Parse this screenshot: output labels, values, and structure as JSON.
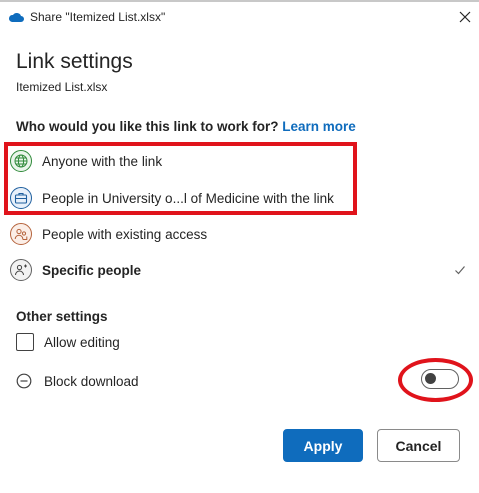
{
  "window": {
    "title": "Share \"Itemized List.xlsx\""
  },
  "dialog": {
    "heading": "Link settings",
    "filename": "Itemized List.xlsx",
    "question": "Who would you like this link to work for?",
    "learn_more": "Learn more",
    "options": [
      {
        "label": "Anyone with the link",
        "icon": "globe-icon"
      },
      {
        "label": "People in University o...l of Medicine with the link",
        "icon": "briefcase-icon"
      },
      {
        "label": "People with existing access",
        "icon": "people-icon"
      },
      {
        "label": "Specific people",
        "icon": "person-icon",
        "selected": true
      }
    ],
    "other_settings": {
      "heading": "Other settings",
      "allow_editing": {
        "label": "Allow editing",
        "checked": false
      },
      "block_download": {
        "label": "Block download",
        "enabled": false
      }
    },
    "buttons": {
      "apply": "Apply",
      "cancel": "Cancel"
    }
  },
  "colors": {
    "accent": "#0f6cbd",
    "annotation_red": "#e0131b",
    "globe": "#2f8a3a",
    "briefcase": "#1f5f9e",
    "people": "#b5633c"
  }
}
